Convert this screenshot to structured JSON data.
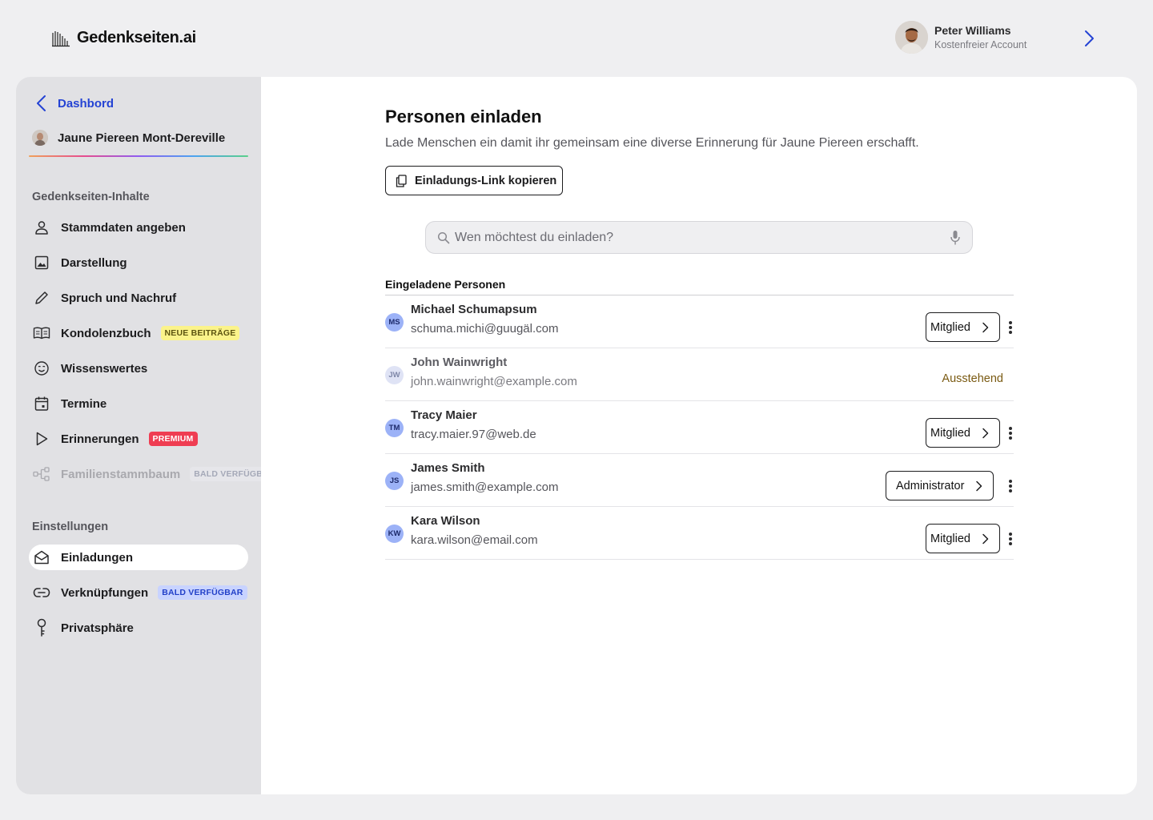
{
  "brand": {
    "name": "Gedenkseiten.ai"
  },
  "user": {
    "name": "Peter Williams",
    "plan": "Kostenfreier Account"
  },
  "sidebar": {
    "back_label": "Dashbord",
    "memorial_name": "Jaune Piereen Mont-Dereville",
    "section_content": "Gedenkseiten-Inhalte",
    "content_items": [
      {
        "label": "Stammdaten angeben",
        "icon": "person-icon"
      },
      {
        "label": "Darstellung",
        "icon": "image-icon"
      },
      {
        "label": "Spruch und Nachruf",
        "icon": "pencil-icon"
      },
      {
        "label": "Kondolenzbuch",
        "icon": "book-icon",
        "badge": "NEUE BEITRÄGE"
      },
      {
        "label": "Wissenswertes",
        "icon": "smiley-icon"
      },
      {
        "label": "Termine",
        "icon": "calendar-icon"
      },
      {
        "label": "Erinnerungen",
        "icon": "play-icon",
        "badge": "PREMIUM"
      },
      {
        "label": "Familienstammbaum",
        "icon": "tree-icon",
        "badge": "BALD VERFÜGBAR",
        "disabled": true
      }
    ],
    "section_settings": "Einstellungen",
    "settings_items": [
      {
        "label": "Einladungen",
        "icon": "mail-icon",
        "active": true
      },
      {
        "label": "Verknüpfungen",
        "icon": "link-icon",
        "badge": "BALD VERFÜGBAR"
      },
      {
        "label": "Privatsphäre",
        "icon": "key-icon"
      }
    ]
  },
  "main": {
    "title": "Personen einladen",
    "subtitle": "Lade Menschen ein damit ihr gemeinsam eine diverse Erinnerung für Jaune Piereen erschafft.",
    "copy_button": "Einladungs-Link kopieren",
    "search_placeholder": "Wen möchtest du einladen?",
    "list_title": "Eingeladene Personen",
    "people": [
      {
        "initials": "MS",
        "name": "Michael Schumapsum",
        "email": "schuma.michi@guugäl.com",
        "role": "Mitglied"
      },
      {
        "initials": "JW",
        "name": "John Wainwright",
        "email": "john.wainwright@example.com",
        "status": "Ausstehend"
      },
      {
        "initials": "TM",
        "name": "Tracy Maier",
        "email": "tracy.maier.97@web.de",
        "role": "Mitglied"
      },
      {
        "initials": "JS",
        "name": "James Smith",
        "email": "james.smith@example.com",
        "role": "Administrator"
      },
      {
        "initials": "KW",
        "name": "Kara Wilson",
        "email": "kara.wilson@email.com",
        "role": "Mitglied"
      }
    ]
  },
  "colors": {
    "accent": "#2443d4",
    "pending": "#7a5a12",
    "sidebar_bg": "#e1e1e4",
    "page_bg": "#efeff1"
  }
}
